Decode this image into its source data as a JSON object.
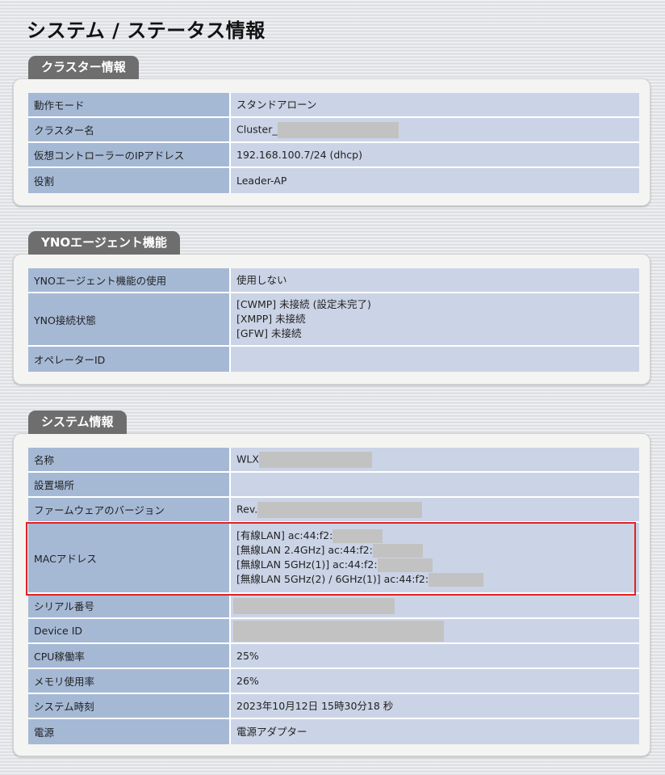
{
  "page": {
    "title": "システム / ステータス情報"
  },
  "cluster": {
    "heading": "クラスター情報",
    "rows": [
      {
        "label": "動作モード",
        "value": "スタンドアローン"
      },
      {
        "label": "クラスター名",
        "value": "Cluster_"
      },
      {
        "label": "仮想コントローラーのIPアドレス",
        "value": "192.168.100.7/24 (dhcp)"
      },
      {
        "label": "役割",
        "value": "Leader-AP"
      }
    ]
  },
  "yno": {
    "heading": "YNOエージェント機能",
    "rows": [
      {
        "label": "YNOエージェント機能の使用",
        "value": "使用しない"
      },
      {
        "label": "YNO接続状態",
        "lines": [
          "[CWMP] 未接続 (設定未完了)",
          "[XMPP] 未接続",
          "[GFW] 未接続"
        ]
      },
      {
        "label": "オペレーターID",
        "value": ""
      }
    ]
  },
  "system": {
    "heading": "システム情報",
    "rows": [
      {
        "label": "名称",
        "value": "WLX"
      },
      {
        "label": "設置場所",
        "value": ""
      },
      {
        "label": "ファームウェアのバージョン",
        "value": "Rev."
      },
      {
        "label": "MACアドレス",
        "lines": [
          "[有線LAN] ac:44:f2:",
          "[無線LAN 2.4GHz] ac:44:f2:",
          "[無線LAN 5GHz(1)] ac:44:f2:",
          "[無線LAN 5GHz(2) / 6GHz(1)] ac:44:f2:"
        ]
      },
      {
        "label": "シリアル番号",
        "value": ""
      },
      {
        "label": "Device ID",
        "value": ""
      },
      {
        "label": "CPU稼働率",
        "value": "25%"
      },
      {
        "label": "メモリ使用率",
        "value": "26%"
      },
      {
        "label": "システム時刻",
        "value": "2023年10月12日 15時30分18 秒"
      },
      {
        "label": "電源",
        "value": "電源アダプター"
      }
    ]
  },
  "colors": {
    "label_bg": "#a5b9d5",
    "value_bg": "#cbd4e6",
    "tab_bg": "#6e6e6e",
    "highlight": "#e12222"
  }
}
